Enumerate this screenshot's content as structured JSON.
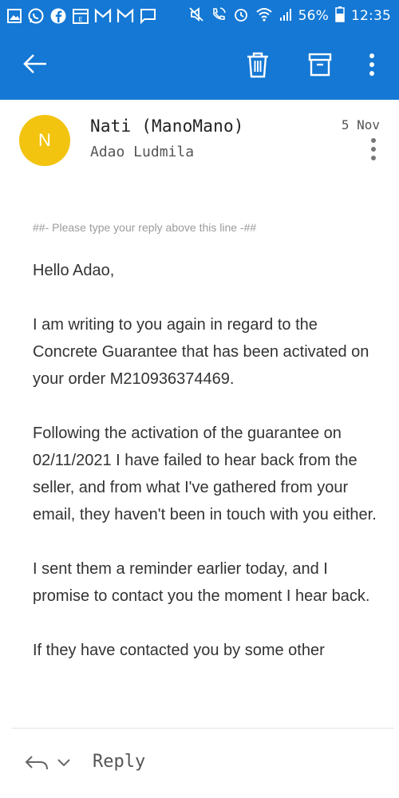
{
  "status_bar": {
    "battery_percent_text": "56%",
    "time": "12:35",
    "icons": [
      "gallery-icon",
      "whatsapp-icon",
      "facebook-icon",
      "calendar-icon",
      "gmail-icon",
      "gmail-icon",
      "message-icon",
      "mute-icon",
      "wifi-calling-icon",
      "alarm-icon",
      "wifi-icon",
      "signal-icon",
      "battery-icon"
    ]
  },
  "app_bar": {
    "back": "back-arrow-icon",
    "actions": [
      "delete-icon",
      "archive-icon",
      "more-vertical-icon"
    ],
    "color": "#1478d4"
  },
  "message": {
    "avatar_initial": "N",
    "avatar_color": "#f2c40f",
    "sender": "Nati (ManoMano)",
    "recipient": "Adao Ludmila",
    "date": "5 Nov",
    "reply_line": "##- Please type your reply above this line -##",
    "paragraphs": [
      "Hello Adao,",
      "I am writing to you again in regard to the Concrete Guarantee that has been activated on your order M210936374469.",
      "Following the activation of the guarantee on 02/11/2021 I have failed to hear back from the seller, and from what I've gathered from your email, they haven't been in touch with you either.",
      "I sent them a reminder earlier today, and I promise to contact you the moment I hear back.",
      "If they have contacted you by some other"
    ]
  },
  "reply_bar": {
    "label": "Reply"
  }
}
